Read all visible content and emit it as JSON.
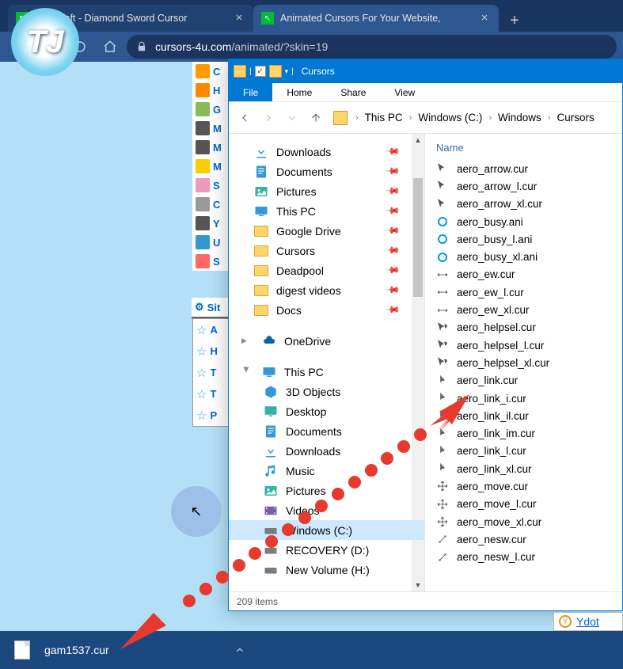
{
  "browser": {
    "tabs": [
      {
        "title": "Minecraft - Diamond Sword Cursor",
        "active": false
      },
      {
        "title": "Animated Cursors For Your Website,",
        "active": true
      }
    ],
    "url_domain": "cursors-4u.com",
    "url_path": "/animated/?skin=19"
  },
  "logo_text": "TJ",
  "site_sidebar_letters": [
    "C",
    "H",
    "G",
    "M",
    "M",
    "M",
    "S",
    "C",
    "Y",
    "U",
    "S"
  ],
  "site_health_label": "Sit",
  "favorites_letters": [
    "A",
    "H",
    "T",
    "T",
    "P"
  ],
  "explorer": {
    "title": "Cursors",
    "ribbon_file": "File",
    "ribbon_tabs": [
      "Home",
      "Share",
      "View"
    ],
    "breadcrumbs": [
      "This PC",
      "Windows (C:)",
      "Windows",
      "Cursors"
    ],
    "tree_pinned": [
      {
        "label": "Downloads",
        "icon": "download"
      },
      {
        "label": "Documents",
        "icon": "doc"
      },
      {
        "label": "Pictures",
        "icon": "pic"
      },
      {
        "label": "This PC",
        "icon": "pc"
      },
      {
        "label": "Google Drive",
        "icon": "folder"
      },
      {
        "label": "Cursors",
        "icon": "folder"
      },
      {
        "label": "Deadpool",
        "icon": "folder"
      },
      {
        "label": "digest videos",
        "icon": "folder"
      },
      {
        "label": "Docs",
        "icon": "folder"
      }
    ],
    "onedrive_label": "OneDrive",
    "thispc_label": "This PC",
    "tree_pc": [
      {
        "label": "3D Objects",
        "icon": "3d"
      },
      {
        "label": "Desktop",
        "icon": "desktop"
      },
      {
        "label": "Documents",
        "icon": "doc"
      },
      {
        "label": "Downloads",
        "icon": "download"
      },
      {
        "label": "Music",
        "icon": "music"
      },
      {
        "label": "Pictures",
        "icon": "pic"
      },
      {
        "label": "Videos",
        "icon": "video"
      },
      {
        "label": "Windows (C:)",
        "icon": "drive",
        "selected": true
      },
      {
        "label": "RECOVERY (D:)",
        "icon": "drive"
      },
      {
        "label": "New Volume (H:)",
        "icon": "drive"
      }
    ],
    "col_name": "Name",
    "files": [
      {
        "name": "aero_arrow.cur",
        "ico": "cursor"
      },
      {
        "name": "aero_arrow_l.cur",
        "ico": "cursor"
      },
      {
        "name": "aero_arrow_xl.cur",
        "ico": "cursor"
      },
      {
        "name": "aero_busy.ani",
        "ico": "busy"
      },
      {
        "name": "aero_busy_l.ani",
        "ico": "busy"
      },
      {
        "name": "aero_busy_xl.ani",
        "ico": "busy"
      },
      {
        "name": "aero_ew.cur",
        "ico": "ew"
      },
      {
        "name": "aero_ew_l.cur",
        "ico": "ew"
      },
      {
        "name": "aero_ew_xl.cur",
        "ico": "ew"
      },
      {
        "name": "aero_helpsel.cur",
        "ico": "help"
      },
      {
        "name": "aero_helpsel_l.cur",
        "ico": "help"
      },
      {
        "name": "aero_helpsel_xl.cur",
        "ico": "help"
      },
      {
        "name": "aero_link.cur",
        "ico": "link"
      },
      {
        "name": "aero_link_i.cur",
        "ico": "link"
      },
      {
        "name": "aero_link_il.cur",
        "ico": "link"
      },
      {
        "name": "aero_link_im.cur",
        "ico": "link"
      },
      {
        "name": "aero_link_l.cur",
        "ico": "link"
      },
      {
        "name": "aero_link_xl.cur",
        "ico": "link"
      },
      {
        "name": "aero_move.cur",
        "ico": "move"
      },
      {
        "name": "aero_move_l.cur",
        "ico": "move"
      },
      {
        "name": "aero_move_xl.cur",
        "ico": "move"
      },
      {
        "name": "aero_nesw.cur",
        "ico": "nesw"
      },
      {
        "name": "aero_nesw_l.cur",
        "ico": "nesw"
      }
    ],
    "status": "209 items"
  },
  "download_file": "gam1537.cur",
  "ydot_label": "Ydot"
}
